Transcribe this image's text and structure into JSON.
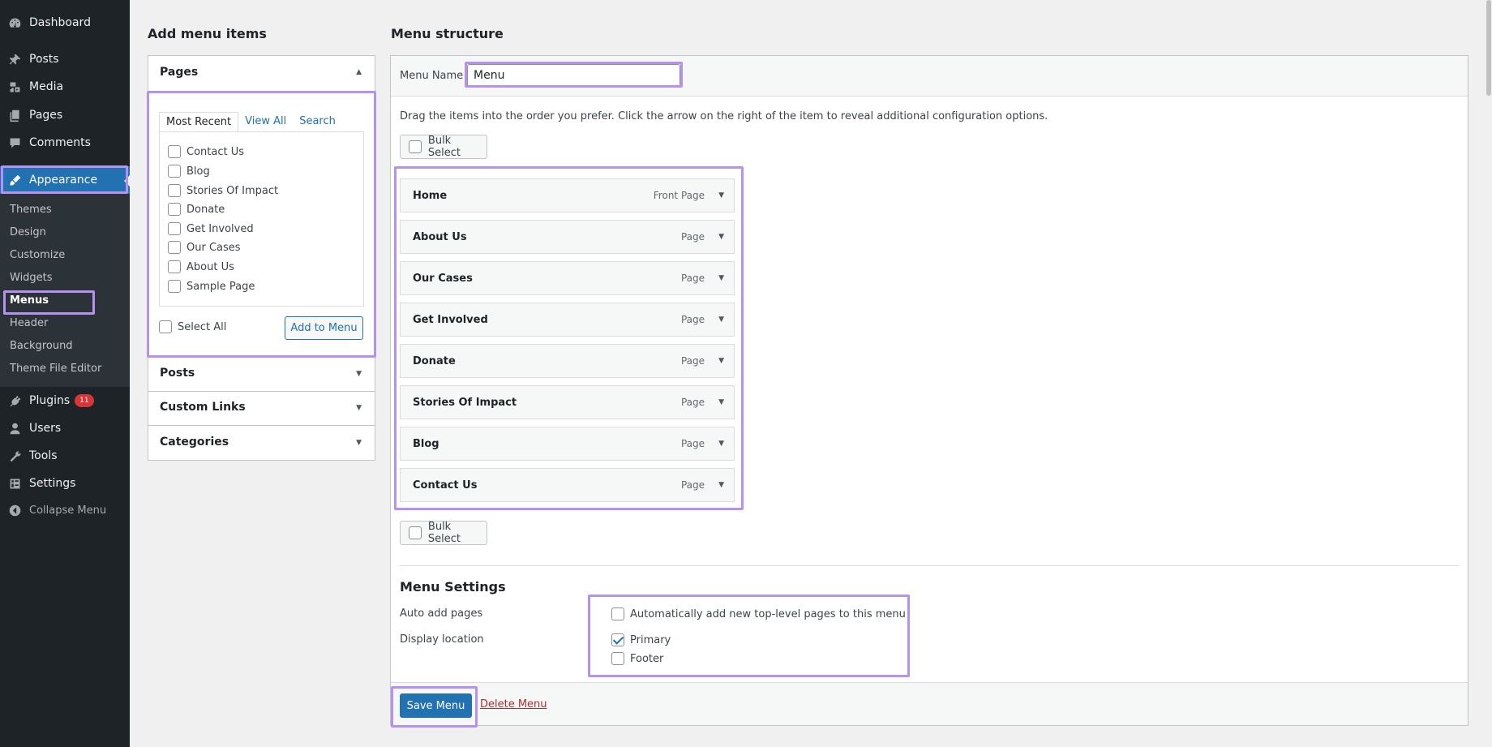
{
  "sidebar": {
    "items": [
      {
        "label": "Dashboard",
        "icon": "dashboard-icon"
      },
      {
        "label": "Posts",
        "icon": "pin-icon"
      },
      {
        "label": "Media",
        "icon": "media-icon"
      },
      {
        "label": "Pages",
        "icon": "pages-icon"
      },
      {
        "label": "Comments",
        "icon": "comment-icon"
      },
      {
        "label": "Appearance",
        "icon": "brush-icon"
      }
    ],
    "submenu": [
      "Themes",
      "Design",
      "Customize",
      "Widgets",
      "Menus",
      "Header",
      "Background",
      "Theme File Editor"
    ],
    "lower": [
      {
        "label": "Plugins",
        "icon": "plugin-icon",
        "badge": "11"
      },
      {
        "label": "Users",
        "icon": "user-icon"
      },
      {
        "label": "Tools",
        "icon": "wrench-icon"
      },
      {
        "label": "Settings",
        "icon": "settings-icon"
      }
    ],
    "collapse": "Collapse Menu"
  },
  "add_items": {
    "title": "Add menu items",
    "pages": {
      "heading": "Pages",
      "tabs": [
        "Most Recent",
        "View All",
        "Search"
      ],
      "items": [
        "Contact Us",
        "Blog",
        "Stories Of Impact",
        "Donate",
        "Get Involved",
        "Our Cases",
        "About Us",
        "Sample Page"
      ],
      "select_all": "Select All",
      "add_button": "Add to Menu"
    },
    "sections": [
      "Posts",
      "Custom Links",
      "Categories"
    ]
  },
  "structure": {
    "title": "Menu structure",
    "name_label": "Menu Name",
    "name_value": "Menu",
    "instructions": "Drag the items into the order you prefer. Click the arrow on the right of the item to reveal additional configuration options.",
    "bulk_select": "Bulk Select",
    "items": [
      {
        "title": "Home",
        "type": "Front Page"
      },
      {
        "title": "About Us",
        "type": "Page"
      },
      {
        "title": "Our Cases",
        "type": "Page"
      },
      {
        "title": "Get Involved",
        "type": "Page"
      },
      {
        "title": "Donate",
        "type": "Page"
      },
      {
        "title": "Stories Of Impact",
        "type": "Page"
      },
      {
        "title": "Blog",
        "type": "Page"
      },
      {
        "title": "Contact Us",
        "type": "Page"
      }
    ]
  },
  "settings": {
    "title": "Menu Settings",
    "auto_add_label": "Auto add pages",
    "auto_add_option": "Automatically add new top-level pages to this menu",
    "display_location_label": "Display location",
    "locations": [
      {
        "label": "Primary",
        "checked": true
      },
      {
        "label": "Footer",
        "checked": false
      }
    ]
  },
  "footer": {
    "save": "Save Menu",
    "delete": "Delete Menu"
  },
  "colors": {
    "accent": "#2271b1",
    "highlight": "#b791f0",
    "danger": "#b32d2e",
    "sidebar_bg": "#1d2327"
  }
}
